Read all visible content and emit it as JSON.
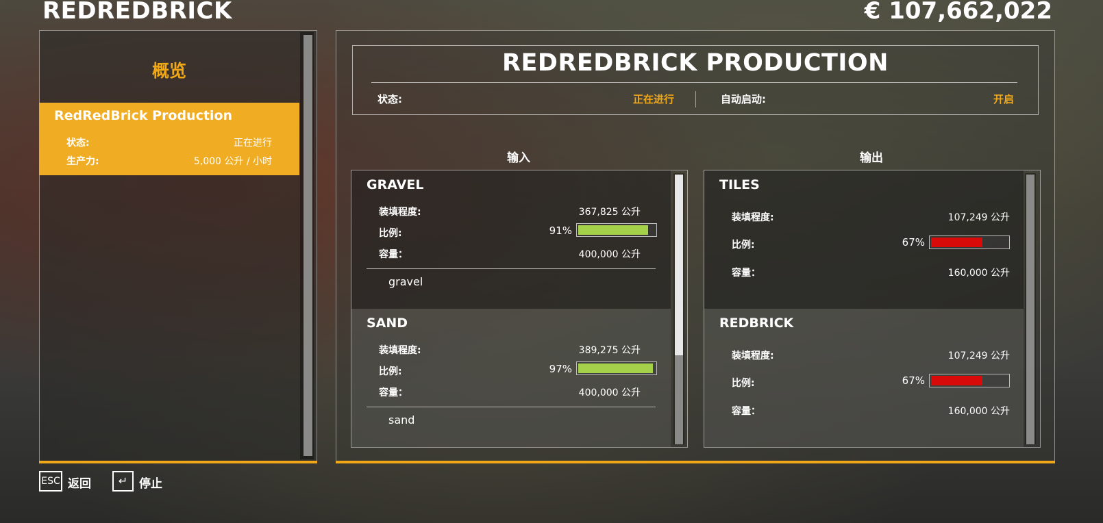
{
  "farm_name": "REDREDBRICK",
  "money": "€ 107,662,022",
  "sidebar": {
    "title": "概览",
    "items": [
      {
        "name": "RedRedBrick Production",
        "status_label": "状态:",
        "status_value": "正在进行",
        "rate_label": "生产力:",
        "rate_value": "5,000 公升 / 小时"
      }
    ]
  },
  "production": {
    "title": "REDREDBRICK PRODUCTION",
    "status_label": "状态:",
    "status_value": "正在进行",
    "autostart_label": "自动启动:",
    "autostart_value": "开启"
  },
  "input_title": "输入",
  "output_title": "输出",
  "inputs": [
    {
      "name": "GRAVEL",
      "fill_label": "装填程度:",
      "fill_value": "367,825 公升",
      "ratio_label": "比例:",
      "ratio_value": "91%",
      "ratio": 0.91,
      "capacity_label": "容量：",
      "capacity_value": "400,000 公升",
      "fill_type": "gravel"
    },
    {
      "name": "SAND",
      "fill_label": "装填程度:",
      "fill_value": "389,275 公升",
      "ratio_label": "比例:",
      "ratio_value": "97%",
      "ratio": 0.97,
      "capacity_label": "容量：",
      "capacity_value": "400,000 公升",
      "fill_type": "sand"
    }
  ],
  "outputs": [
    {
      "name": "TILES",
      "fill_label": "装填程度:",
      "fill_value": "107,249 公升",
      "ratio_label": "比例:",
      "ratio_value": "67%",
      "ratio": 0.67,
      "capacity_label": "容量：",
      "capacity_value": "160,000 公升"
    },
    {
      "name": "REDBRICK",
      "fill_label": "装填程度:",
      "fill_value": "107,249 公升",
      "ratio_label": "比例:",
      "ratio_value": "67%",
      "ratio": 0.67,
      "capacity_label": "容量：",
      "capacity_value": "160,000 公升"
    }
  ],
  "footer": {
    "back_key": "ESC",
    "back_label": "返回",
    "stop_key": "↵",
    "stop_label": "停止"
  },
  "colors": {
    "accent": "#f0a818",
    "bar_green": "#a4d04a",
    "bar_red": "#d90a0a"
  }
}
